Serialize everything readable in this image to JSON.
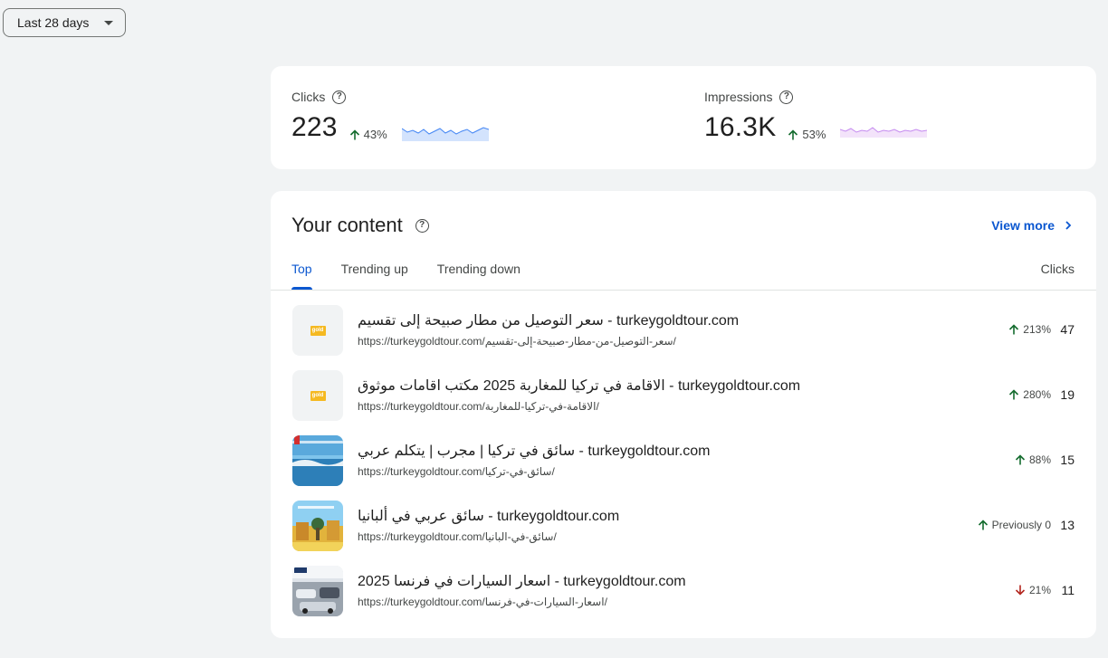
{
  "filter": {
    "date_range": "Last 28 days"
  },
  "metrics": {
    "clicks": {
      "label": "Clicks",
      "value": "223",
      "change": "43%",
      "direction": "up",
      "color": "#a8c7fa"
    },
    "impressions": {
      "label": "Impressions",
      "value": "16.3K",
      "change": "53%",
      "direction": "up",
      "color": "#e7c6f5"
    }
  },
  "content": {
    "title": "Your content",
    "view_more": "View more",
    "tabs": [
      {
        "label": "Top",
        "active": true
      },
      {
        "label": "Trending up",
        "active": false
      },
      {
        "label": "Trending down",
        "active": false
      }
    ],
    "column_header": "Clicks",
    "rows": [
      {
        "title": "سعر التوصيل من مطار صبيحة إلى تقسيم - turkeygoldtour.com",
        "url": "https://turkeygoldtour.com/سعر-التوصيل-من-مطار-صبيحة-إلى-تقسيم/",
        "change": "213%",
        "direction": "up",
        "clicks": "47",
        "thumb": "gold-logo"
      },
      {
        "title": "الاقامة في تركيا للمغاربة 2025 مكتب اقامات موثوق - turkeygoldtour.com",
        "url": "https://turkeygoldtour.com/الاقامة-في-تركيا-للمغاربة/",
        "change": "280%",
        "direction": "up",
        "clicks": "19",
        "thumb": "gold-logo"
      },
      {
        "title": "سائق في تركيا | مجرب | يتكلم عربي - turkeygoldtour.com",
        "url": "https://turkeygoldtour.com/سائق-في-تركيا/",
        "change": "88%",
        "direction": "up",
        "clicks": "15",
        "thumb": "sea-photo"
      },
      {
        "title": "سائق عربي في ألبانيا - turkeygoldtour.com",
        "url": "https://turkeygoldtour.com/سائق-في-البانيا/",
        "change": "Previously 0",
        "direction": "up",
        "clicks": "13",
        "thumb": "city-photo"
      },
      {
        "title": "اسعار السيارات في فرنسا 2025 - turkeygoldtour.com",
        "url": "https://turkeygoldtour.com/اسعار-السيارات-في-فرنسا/",
        "change": "21%",
        "direction": "down",
        "clicks": "11",
        "thumb": "cars-photo"
      }
    ],
    "thumb_logo_text": "gold"
  },
  "colors": {
    "accent": "#0b57d0",
    "up": "#146c2e",
    "down": "#b3261e"
  }
}
